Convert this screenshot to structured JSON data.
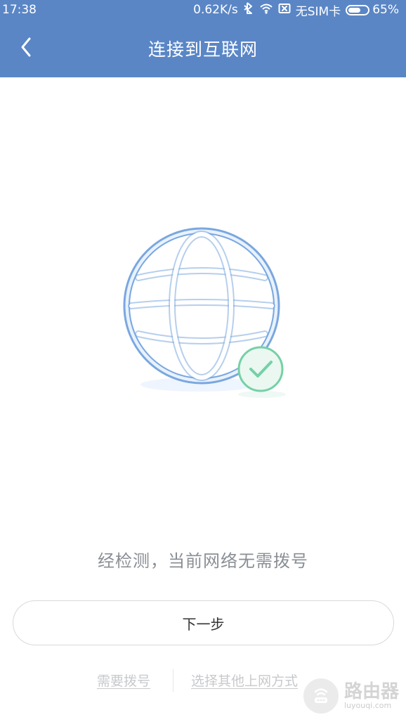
{
  "status_bar": {
    "time": "17:38",
    "speed": "0.62K/s",
    "sim": "无SIM卡",
    "battery": "65%",
    "battery_level": 0.65
  },
  "header": {
    "title": "连接到互联网"
  },
  "main": {
    "message": "经检测，当前网络无需拨号",
    "next_button": "下一步",
    "links": {
      "dial": "需要拨号",
      "other": "选择其他上网方式"
    }
  },
  "watermark": {
    "main": "路由器",
    "sub": "luyouqi.com"
  },
  "colors": {
    "header_bg": "#5a86c6",
    "globe_stroke": "#7aa7df",
    "globe_fill": "#e8f2ff",
    "check_stroke": "#76d0a6",
    "check_fill": "#eaf8f1"
  },
  "icons": {
    "back": "chevron-left-icon",
    "bluetooth": "bluetooth-icon",
    "wifi": "wifi-icon",
    "sim": "sim-icon",
    "battery": "battery-icon",
    "globe": "globe-icon",
    "check": "check-circle-icon",
    "watermark": "router-icon"
  }
}
